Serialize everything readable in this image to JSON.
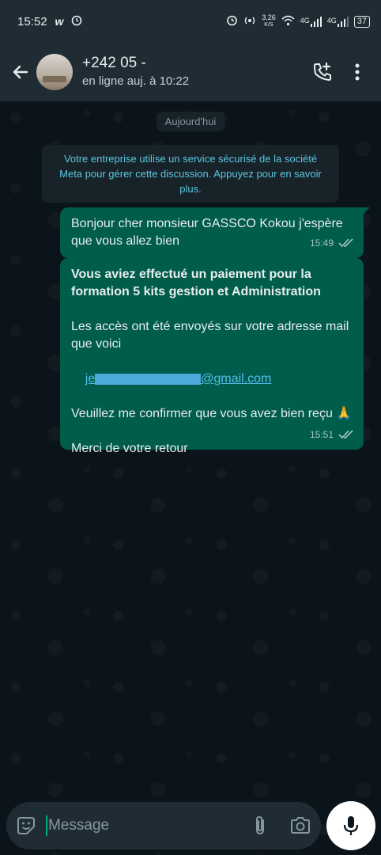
{
  "status_bar": {
    "time": "15:52",
    "network_speed_value": "3,26",
    "network_speed_unit": "K/S",
    "net1": "4G",
    "net2": "4G",
    "battery": "37"
  },
  "header": {
    "contact_name": "+242 05 -",
    "contact_status": "en ligne auj. à 10:22"
  },
  "chat": {
    "date_chip": "Aujourd'hui",
    "notice_prefix": "Votre entreprise utilise un service sécurisé de la société Meta pour gérer cette discussion. ",
    "notice_link": "Appuyez pour en savoir plus.",
    "messages": [
      {
        "text": "Bonjour cher monsieur GASSCO Kokou j'espère que vous allez bien",
        "time": "15:49"
      },
      {
        "bold": "Vous aviez effectué un paiement pour la formation 5 kits gestion et Administration",
        "line1": "Les accès ont été envoyés sur votre adresse mail que voici",
        "email_prefix": "je",
        "email_suffix": "@gmail.com",
        "line2": "Veuillez me confirmer que vous avez bien reçu 🙏",
        "line3": "Merci de votre retour",
        "time": "15:51"
      }
    ]
  },
  "input": {
    "placeholder": "Message"
  },
  "colors": {
    "header_bg": "#1f2c34",
    "bubble_out": "#005c4b",
    "accent": "#00a884"
  }
}
